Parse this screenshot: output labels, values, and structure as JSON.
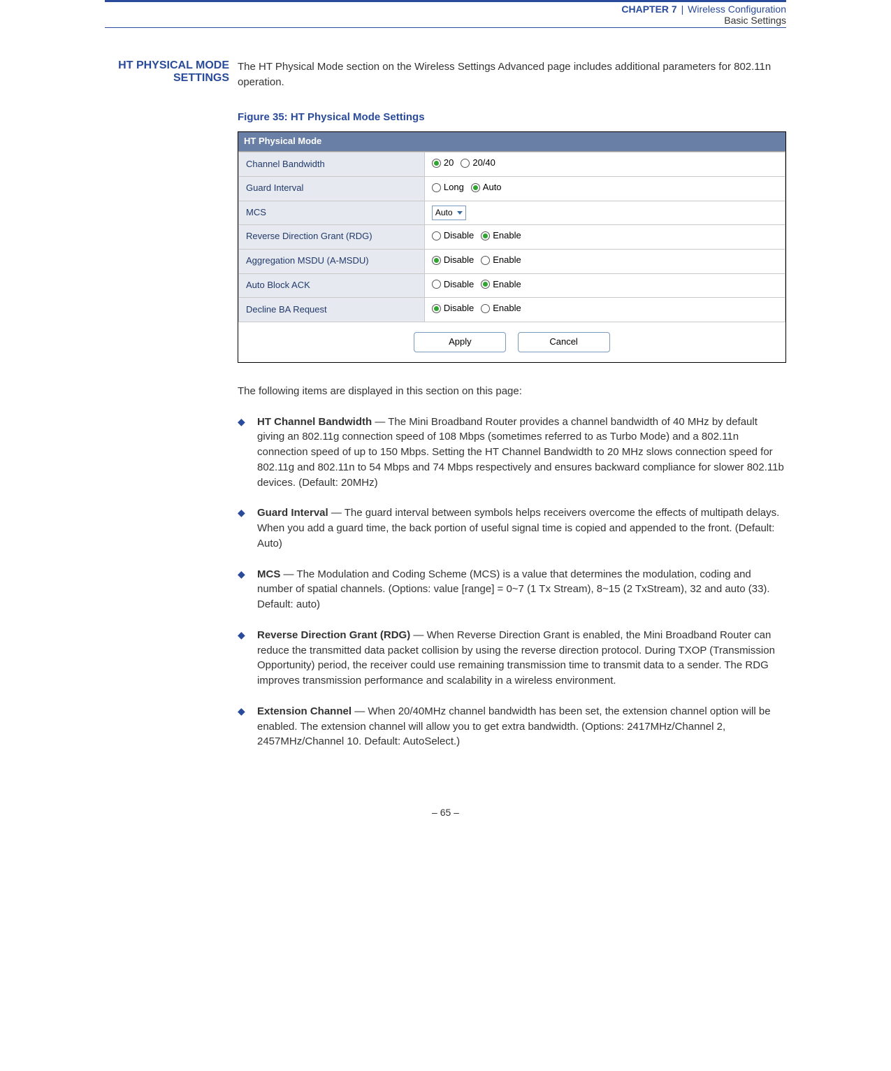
{
  "header": {
    "chapter_label": "CHAPTER 7",
    "separator": "|",
    "chapter_name": "Wireless Configuration",
    "sub": "Basic Settings"
  },
  "section": {
    "side_title_line1": "HT PHYSICAL MODE",
    "side_title_line2": "SETTINGS",
    "intro": "The HT Physical Mode section on the Wireless Settings Advanced page includes additional parameters for 802.11n operation."
  },
  "figure": {
    "caption": "Figure 35:  HT Physical Mode Settings",
    "panel_title": "HT Physical Mode",
    "rows": [
      {
        "label": "Channel Bandwidth",
        "type": "radio",
        "options": [
          {
            "text": "20",
            "checked": true
          },
          {
            "text": "20/40",
            "checked": false
          }
        ]
      },
      {
        "label": "Guard Interval",
        "type": "radio",
        "options": [
          {
            "text": "Long",
            "checked": false
          },
          {
            "text": "Auto",
            "checked": true
          }
        ]
      },
      {
        "label": "MCS",
        "type": "select",
        "value": "Auto"
      },
      {
        "label": "Reverse Direction Grant (RDG)",
        "type": "radio",
        "options": [
          {
            "text": "Disable",
            "checked": false
          },
          {
            "text": "Enable",
            "checked": true
          }
        ]
      },
      {
        "label": "Aggregation MSDU (A-MSDU)",
        "type": "radio",
        "options": [
          {
            "text": "Disable",
            "checked": true
          },
          {
            "text": "Enable",
            "checked": false
          }
        ]
      },
      {
        "label": "Auto Block ACK",
        "type": "radio",
        "options": [
          {
            "text": "Disable",
            "checked": false
          },
          {
            "text": "Enable",
            "checked": true
          }
        ]
      },
      {
        "label": "Decline BA Request",
        "type": "radio",
        "options": [
          {
            "text": "Disable",
            "checked": true
          },
          {
            "text": "Enable",
            "checked": false
          }
        ]
      }
    ],
    "apply_btn": "Apply",
    "cancel_btn": "Cancel"
  },
  "description": {
    "intro": "The following items are displayed in this section on this page:",
    "items": [
      {
        "term": "HT Channel Bandwidth",
        "text": " — The Mini Broadband Router provides a channel bandwidth of 40 MHz by default giving an 802.11g connection speed of 108 Mbps (sometimes referred to as Turbo Mode) and a 802.11n connection speed of up to 150 Mbps. Setting the HT Channel Bandwidth to 20 MHz slows connection speed for 802.11g and 802.11n to 54 Mbps and 74 Mbps respectively and ensures backward compliance for slower 802.11b devices. (Default: 20MHz)"
      },
      {
        "term": "Guard Interval",
        "text": " — The guard interval between symbols helps receivers overcome the effects of multipath delays. When you add a guard time, the back portion of useful signal time is copied and appended to the front. (Default: Auto)"
      },
      {
        "term": "MCS",
        "text": " — The Modulation and Coding Scheme (MCS) is a value that determines the modulation, coding and number of spatial channels. (Options: value [range] = 0~7 (1 Tx Stream), 8~15 (2 TxStream), 32 and auto (33). Default: auto)"
      },
      {
        "term": "Reverse Direction Grant (RDG)",
        "text": " — When Reverse Direction Grant is enabled, the Mini Broadband Router can reduce the transmitted data packet collision by using the reverse direction protocol. During TXOP (Transmission Opportunity) period, the receiver could use remaining transmission time to transmit data to a sender. The RDG improves transmission performance and scalability in a wireless environment."
      },
      {
        "term": "Extension Channel",
        "text": " — When 20/40MHz channel bandwidth has been set, the extension channel option will be enabled. The extension channel will allow you to get extra bandwidth. (Options: 2417MHz/Channel 2, 2457MHz/Channel 10. Default: AutoSelect.)"
      }
    ]
  },
  "footer": {
    "page": "–  65  –"
  }
}
